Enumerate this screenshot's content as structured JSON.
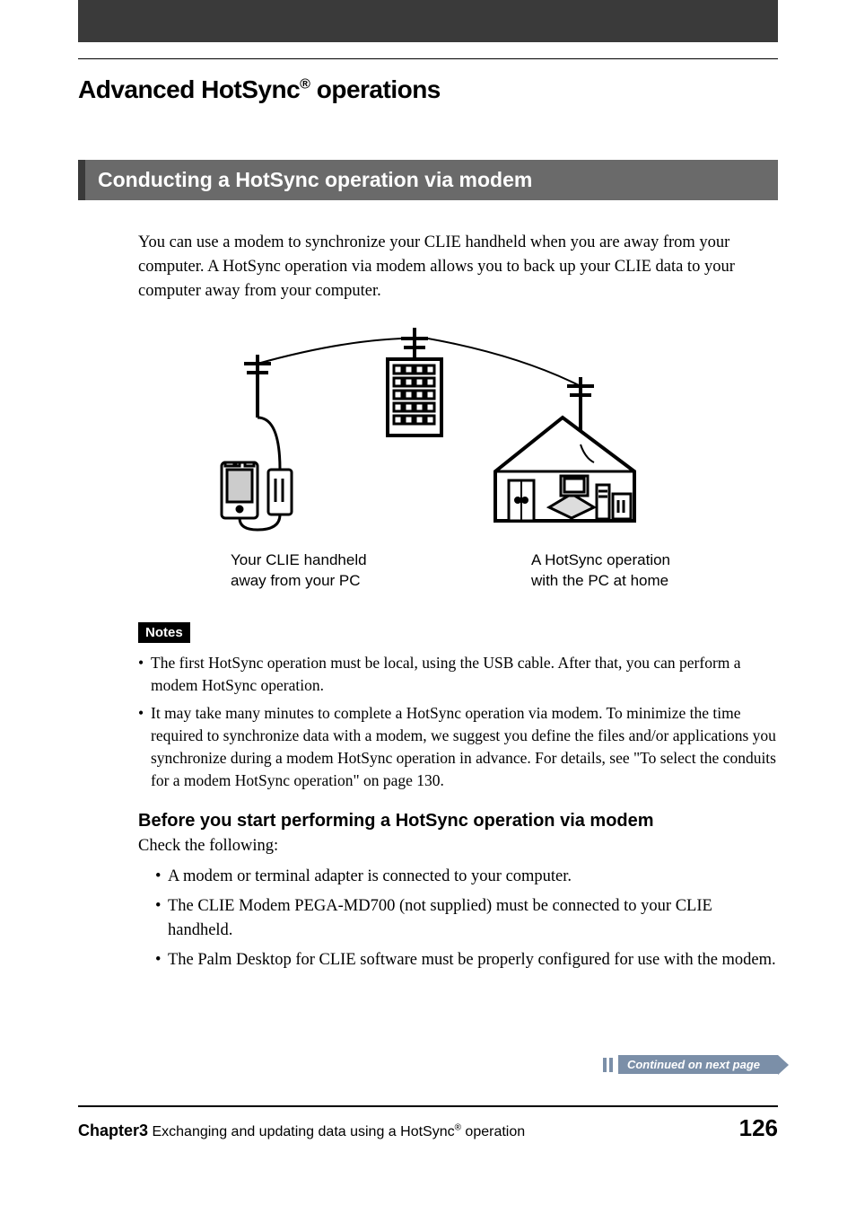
{
  "header": {
    "title_pre": "Advanced HotSync",
    "title_sup": "®",
    "title_post": " operations"
  },
  "section": {
    "title": "Conducting a HotSync operation via modem",
    "intro": "You can use a modem to synchronize your CLIE handheld when you are away from your computer. A HotSync operation via modem allows you to back up your CLIE data to your computer away from your computer."
  },
  "diagram": {
    "caption_left_l1": "Your CLIE handheld",
    "caption_left_l2": "away from your PC",
    "caption_right_l1": "A HotSync operation",
    "caption_right_l2": "with the PC at home"
  },
  "notes": {
    "label": "Notes",
    "items": [
      "The first HotSync operation must be local, using the USB cable. After that, you can perform a modem HotSync operation.",
      "It may take many minutes to complete a HotSync operation via modem. To minimize the time required to synchronize data with a modem, we suggest you define the files and/or applications you synchronize during a modem HotSync operation in advance. For details, see \"To select the conduits for a modem HotSync operation\" on page 130."
    ]
  },
  "before": {
    "heading": "Before you start performing a HotSync operation via modem",
    "lead": "Check the following:",
    "items": [
      "A modem or terminal adapter is connected to your computer.",
      "The CLIE Modem PEGA-MD700 (not supplied) must be connected to your CLIE handheld.",
      "The Palm Desktop for CLIE software must be properly configured for use with the modem."
    ]
  },
  "continued": "Continued on next page",
  "footer": {
    "chapter_label": "Chapter3",
    "chapter_text_pre": "  Exchanging and updating data using a HotSync",
    "chapter_sup": "®",
    "chapter_text_post": " operation",
    "page": "126"
  }
}
